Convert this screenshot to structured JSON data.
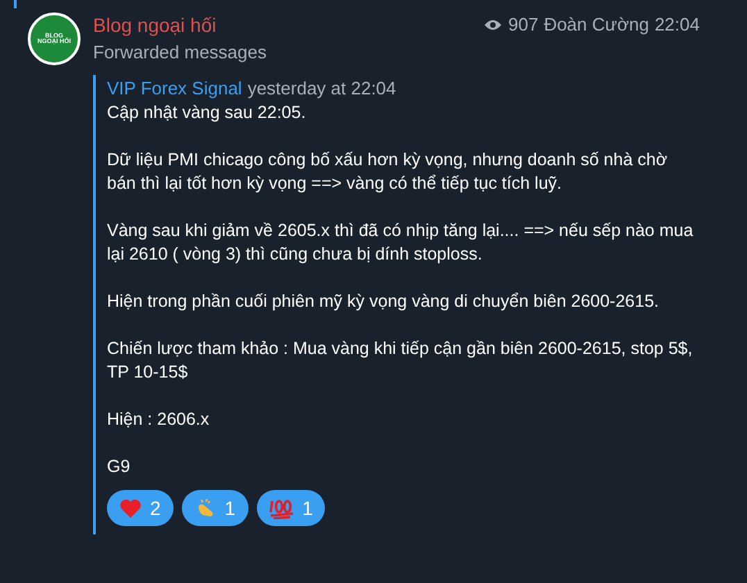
{
  "avatar": {
    "text": "BLOG NGOẠI HỐI"
  },
  "channel_name": "Blog ngoại hối",
  "views": "907",
  "author": "Đoàn Cường",
  "time": "22:04",
  "subtitle": "Forwarded messages",
  "forward": {
    "source": "VIP Forex Signal",
    "date": "yesterday at 22:04",
    "paragraphs": [
      "Cập nhật vàng sau 22:05.",
      "Dữ liệu PMI chicago công bố xấu hơn kỳ vọng, nhưng doanh số nhà chờ bán thì lại tốt hơn kỳ vọng ==> vàng có thể tiếp tục tích luỹ.",
      "Vàng sau khi giảm về 2605.x thì đã có nhịp tăng lại.... ==> nếu sếp nào mua lại 2610 ( vòng 3) thì cũng chưa bị dính stoploss.",
      "Hiện trong phần cuối phiên mỹ kỳ vọng vàng di chuyển biên 2600-2615.",
      "Chiến lược tham khảo : Mua vàng khi tiếp cận gần biên 2600-2615, stop 5$, TP 10-15$",
      "Hiện : 2606.x",
      "G9"
    ]
  },
  "reactions": [
    {
      "kind": "heart",
      "count": "2"
    },
    {
      "kind": "clap",
      "count": "1"
    },
    {
      "kind": "hundred",
      "count": "1"
    }
  ]
}
